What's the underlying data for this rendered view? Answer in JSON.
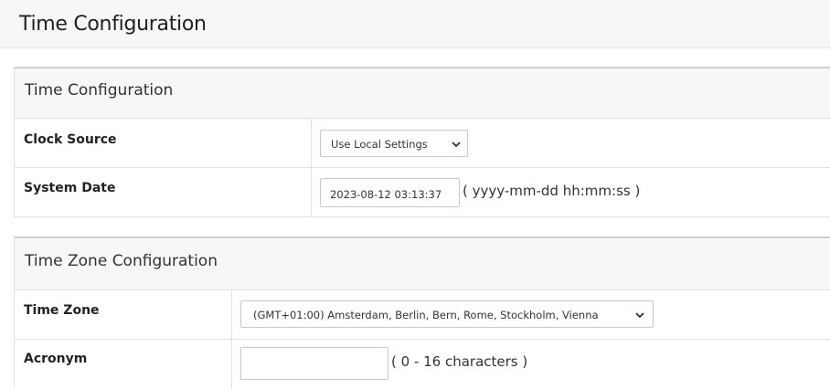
{
  "page": {
    "title": "Time Configuration"
  },
  "time_configuration": {
    "heading": "Time Configuration",
    "clock_source": {
      "label": "Clock Source",
      "selected": "Use Local Settings",
      "icon": "chevron-down-icon"
    },
    "system_date": {
      "label": "System Date",
      "value": "2023-08-12 03:13:37",
      "hint": "( yyyy-mm-dd hh:mm:ss )"
    }
  },
  "time_zone_configuration": {
    "heading": "Time Zone Configuration",
    "time_zone": {
      "label": "Time Zone",
      "selected": "(GMT+01:00) Amsterdam, Berlin, Bern, Rome, Stockholm, Vienna",
      "icon": "chevron-down-icon"
    },
    "acronym": {
      "label": "Acronym",
      "value": "",
      "hint": "( 0 - 16 characters )"
    }
  }
}
